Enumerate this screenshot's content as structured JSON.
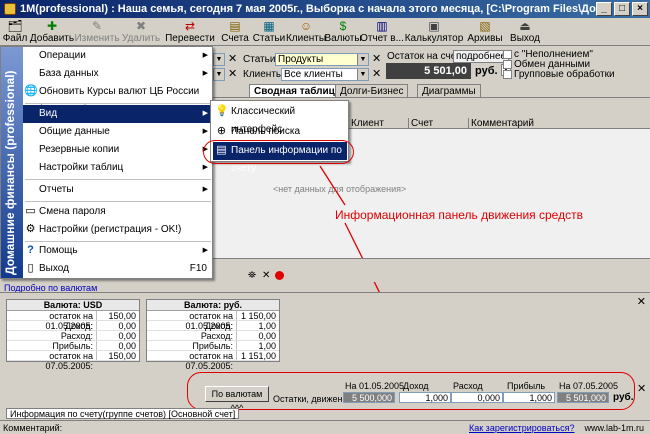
{
  "window": {
    "title": "1M(professional) : Наша семья, сегодня 7 мая 2005г., Выборка с начала этого месяца, [C:\\Program Files\\Домашние финансы (professional)\\DATA\\]",
    "minimize": "_",
    "maximize": "□",
    "close": "×"
  },
  "toolbar": {
    "items": [
      {
        "label": "Файл",
        "icon": "file-icon",
        "glyph": "🗂"
      },
      {
        "label": "Добавить",
        "icon": "add-icon",
        "glyph": "✚"
      },
      {
        "label": "Изменить",
        "icon": "edit-icon",
        "glyph": "✎"
      },
      {
        "label": "Удалить",
        "icon": "delete-icon",
        "glyph": "✖"
      },
      {
        "label": "Перевести",
        "icon": "transfer-icon",
        "glyph": "⇄"
      },
      {
        "label": "Счета",
        "icon": "accounts-icon",
        "glyph": "▤"
      },
      {
        "label": "Статьи",
        "icon": "articles-icon",
        "glyph": "▦"
      },
      {
        "label": "Клиенты",
        "icon": "clients-icon",
        "glyph": "☺"
      },
      {
        "label": "Валюты",
        "icon": "currencies-icon",
        "glyph": "$"
      },
      {
        "label": "Отчет в...",
        "icon": "report-icon",
        "glyph": "▥"
      },
      {
        "label": "Калькулятор",
        "icon": "calculator-icon",
        "glyph": "▣"
      },
      {
        "label": "Архивы",
        "icon": "archives-icon",
        "glyph": "▧"
      },
      {
        "label": "Выход",
        "icon": "exit-icon",
        "glyph": "⏏"
      }
    ]
  },
  "filters": {
    "articles_label": "Статьи",
    "articles_value": "Продукты",
    "clients_label": "Клиенты",
    "clients_value": "Все клиенты",
    "balance_label": "Остаток на счете",
    "details_button": "подробнее",
    "balance_value": "5 501,00",
    "currency": "руб.",
    "cb_unlimited": "с \"Неполнением\"",
    "cb_exchange": "Обмен данными",
    "cb_group": "Групповые обработки"
  },
  "tabs": [
    "Сводная таблица",
    "Долги-Бизнес",
    "Диаграммы"
  ],
  "grid": {
    "columns": [
      "Клиент",
      "Счет",
      "Комментарий"
    ],
    "empty_text": "<нет данных для отображения>"
  },
  "annotation": {
    "text": "Информационная панель движения средств",
    "color": "#e00000"
  },
  "currency_panel": {
    "link": "Подробно по валютам",
    "tables": [
      {
        "title": "Валюта: USD",
        "rows": [
          {
            "label": "остаток на 01.05.2005:",
            "value": "150,00"
          },
          {
            "label": "Доход:",
            "value": "0,00"
          },
          {
            "label": "Расход:",
            "value": "0,00"
          },
          {
            "label": "Прибыль:",
            "value": "0,00"
          },
          {
            "label": "остаток на 07.05.2005:",
            "value": "150,00"
          }
        ]
      },
      {
        "title": "Валюта: руб.",
        "rows": [
          {
            "label": "остаток на 01.05.2005:",
            "value": "1 150,00"
          },
          {
            "label": "Доход:",
            "value": "1,00"
          },
          {
            "label": "Расход:",
            "value": "0,00"
          },
          {
            "label": "Прибыль:",
            "value": "1,00"
          },
          {
            "label": "остаток на 07.05.2005:",
            "value": "1 151,00"
          }
        ]
      }
    ]
  },
  "info_panel": {
    "button": "По валютам ^^^",
    "row_label": "Остатки, движение:",
    "col_start": "На 01.05.2005",
    "col_income": "Доход",
    "col_expense": "Расход",
    "col_profit": "Прибыль",
    "col_end": "На 07.05.2005",
    "val_start": "5 500,000",
    "val_income": "1,000",
    "val_expense": "0,000",
    "val_profit": "1,000",
    "val_end": "5 501,000",
    "currency": "руб."
  },
  "status": {
    "tab_label": "Информация по счету(группе счетов) [Основной счет]",
    "left": "Комментарий:",
    "register_link": "Как зарегистрироваться?",
    "site": "www.lab-1m.ru"
  },
  "menu": {
    "strip_text": "Домашние финансы (professional)",
    "items": [
      {
        "label": "Операции",
        "has_sub": true,
        "icon": ""
      },
      {
        "label": "База данных",
        "has_sub": true,
        "icon": ""
      },
      {
        "label": "Обновить Курсы валют ЦБ России (интернет)",
        "has_sub": false,
        "icon": "globe-icon",
        "glyph": "🌐"
      },
      {
        "label": "Вид",
        "has_sub": true,
        "icon": "",
        "highlighted": true
      },
      {
        "label": "Общие данные",
        "has_sub": true,
        "icon": ""
      },
      {
        "label": "Резервные копии",
        "has_sub": true,
        "icon": ""
      },
      {
        "label": "Настройки таблиц",
        "has_sub": true,
        "icon": ""
      },
      {
        "label": "Отчеты",
        "has_sub": true,
        "icon": ""
      },
      {
        "label": "Смена пароля",
        "has_sub": false,
        "icon": "password-icon",
        "glyph": "▭"
      },
      {
        "label": "Настройки (регистрация - OK!)",
        "has_sub": false,
        "icon": "settings-icon",
        "glyph": "⚙"
      },
      {
        "label": "Помощь",
        "has_sub": true,
        "icon": "help-icon",
        "glyph": "?"
      },
      {
        "label": "Выход",
        "has_sub": false,
        "icon": "exit-icon",
        "glyph": "▯",
        "shortcut": "F10"
      }
    ],
    "submenu": [
      {
        "label": "Классический интерфейс",
        "icon": "bulb-icon",
        "glyph": "💡"
      },
      {
        "label": "Панель поиска",
        "icon": "binoculars-icon",
        "glyph": "⊕"
      },
      {
        "label": "Панель информации по счету",
        "icon": "chart-panel-icon",
        "glyph": "▤",
        "highlighted": true
      }
    ]
  }
}
